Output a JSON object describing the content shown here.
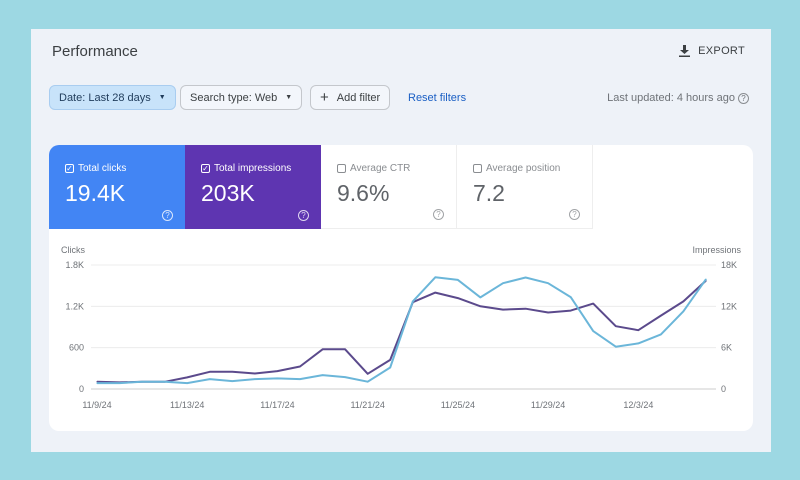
{
  "header": {
    "title": "Performance",
    "export_label": "EXPORT",
    "export_icon": "download-icon"
  },
  "filters": {
    "date": "Date: Last 28 days",
    "search_type": "Search type: Web",
    "add_filter": "Add filter",
    "reset": "Reset filters",
    "last_updated": "Last updated: 4 hours ago"
  },
  "metrics": [
    {
      "label": "Total clicks",
      "value": "19.4K",
      "checked": true,
      "color": "#4285f4"
    },
    {
      "label": "Total impressions",
      "value": "203K",
      "checked": true,
      "color": "#5e35b1"
    },
    {
      "label": "Average CTR",
      "value": "9.6%",
      "checked": false
    },
    {
      "label": "Average position",
      "value": "7.2",
      "checked": false
    }
  ],
  "chart_data": {
    "type": "line",
    "left_axis": {
      "label": "Clicks",
      "ticks": [
        "0",
        "600",
        "1.2K",
        "1.8K"
      ],
      "range": [
        0,
        1800
      ]
    },
    "right_axis": {
      "label": "Impressions",
      "ticks": [
        "0",
        "6K",
        "12K",
        "18K"
      ],
      "range": [
        0,
        18000
      ]
    },
    "x_ticks": [
      "11/9/24",
      "11/13/24",
      "11/17/24",
      "11/21/24",
      "11/25/24",
      "11/29/24",
      "12/3/24"
    ],
    "grid": true,
    "series": [
      {
        "axis": "left",
        "color": "#6bb6d9",
        "values": [
          86,
          86,
          106,
          106,
          86,
          144,
          115,
          144,
          154,
          144,
          202,
          173,
          106,
          312,
          1272,
          1622,
          1584,
          1330,
          1536,
          1618,
          1536,
          1334,
          840,
          614,
          662,
          792,
          1128,
          1594
        ]
      },
      {
        "axis": "right",
        "color": "#5b4a8c",
        "values": [
          1056,
          960,
          1050,
          1050,
          1680,
          2500,
          2500,
          2250,
          2600,
          3260,
          5760,
          5760,
          2200,
          4220,
          12600,
          14000,
          13200,
          12000,
          11520,
          11660,
          11100,
          11380,
          12400,
          9120,
          8540,
          10660,
          12720,
          15740
        ]
      }
    ]
  }
}
